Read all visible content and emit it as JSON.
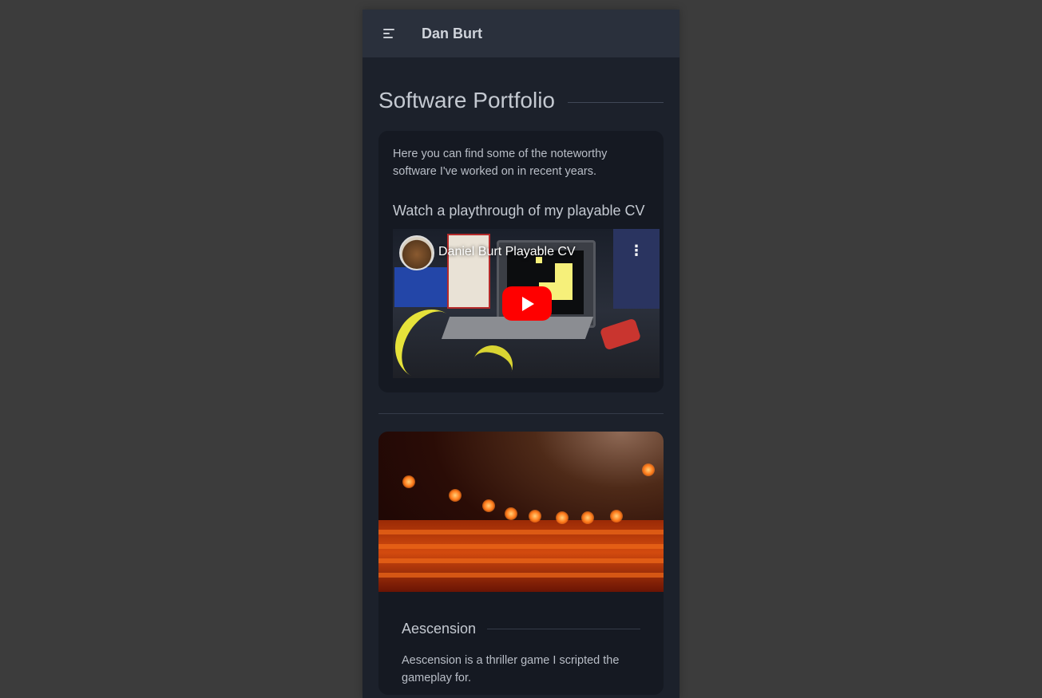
{
  "header": {
    "title": "Dan Burt",
    "menu_icon": "hamburger-menu-icon"
  },
  "page": {
    "title": "Software Portfolio"
  },
  "intro": {
    "text": "Here you can find some of the noteworthy software I've worked on in recent years.",
    "video_heading": "Watch a playthrough of my playable CV",
    "video": {
      "title": "Daniel Burt Playable CV",
      "more_label": "⋮",
      "play_icon": "youtube-play-icon"
    }
  },
  "projects": [
    {
      "title": "Aescension",
      "description": "Aescension is a thriller game I scripted the gameplay for."
    }
  ],
  "colors": {
    "background": "#3c3c3c",
    "page": "#1c212b",
    "header": "#2a303c",
    "card": "#151922",
    "play_button": "#ff0000"
  }
}
